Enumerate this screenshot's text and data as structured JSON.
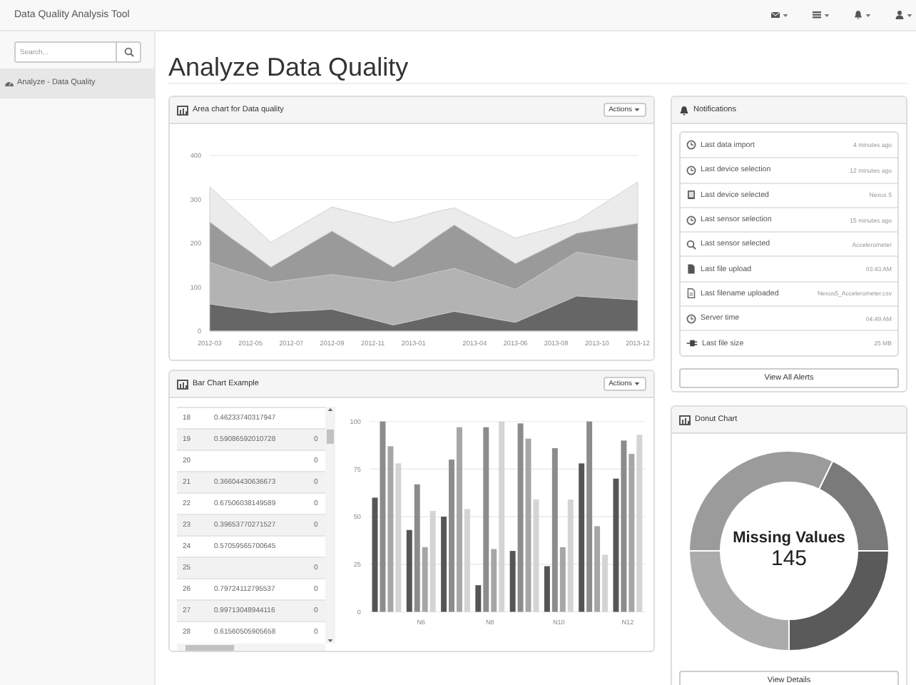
{
  "navbar": {
    "brand": "Data Quality Analysis Tool"
  },
  "sidebar": {
    "search": {
      "placeholder": "Search..."
    },
    "items": [
      {
        "label": "Analyze - Data Quality",
        "selected": true
      }
    ]
  },
  "page_title": "Analyze Data Quality",
  "area_panel": {
    "title": "Area chart for Data quality",
    "actions": "Actions",
    "chart_data": {
      "type": "area",
      "stacked": true,
      "grid": true,
      "ylim": [
        0,
        400
      ],
      "yticks": [
        0,
        100,
        200,
        300,
        400
      ],
      "categories": [
        "2012-03",
        null,
        "2012-05",
        null,
        "2012-07",
        null,
        "2012-09",
        null,
        "2012-11",
        null,
        "2013-01",
        null,
        null,
        "2013-04",
        null,
        "2013-06",
        null,
        "2013-08",
        null,
        "2013-10",
        null,
        "2013-12"
      ],
      "series": [
        {
          "color": "#666666",
          "values": [
            62,
            55,
            49,
            42,
            45,
            47,
            50,
            38,
            26,
            14,
            24,
            35,
            45,
            37,
            28,
            20,
            40,
            60,
            80,
            77,
            74,
            71
          ]
        },
        {
          "color": "#b3b3b3",
          "values": [
            95,
            86,
            78,
            69,
            72,
            76,
            79,
            85,
            91,
            97,
            97,
            98,
            98,
            90,
            83,
            75,
            83,
            92,
            100,
            96,
            92,
            88
          ]
        },
        {
          "color": "#9a9a9a",
          "values": [
            92,
            73,
            54,
            35,
            56,
            78,
            99,
            78,
            56,
            35,
            56,
            78,
            99,
            86,
            72,
            59,
            54,
            48,
            43,
            58,
            72,
            87
          ]
        },
        {
          "color": "#ebebeb",
          "values": [
            80,
            72,
            64,
            56,
            56,
            55,
            55,
            70,
            86,
            101,
            80,
            60,
            39,
            45,
            52,
            58,
            48,
            38,
            28,
            50,
            72,
            94
          ]
        }
      ]
    }
  },
  "bar_panel": {
    "title": "Bar Chart Example",
    "actions": "Actions",
    "table": {
      "rows": [
        {
          "index": "18",
          "value": "0.46233740317947",
          "column_3": ""
        },
        {
          "index": "19",
          "value": "0.59086592010728",
          "column_3": "0"
        },
        {
          "index": "20",
          "value": "",
          "column_3": "0"
        },
        {
          "index": "21",
          "value": "0.36604430636673",
          "column_3": "0"
        },
        {
          "index": "22",
          "value": "0.67506038149589",
          "column_3": "0"
        },
        {
          "index": "23",
          "value": "0.39653770271527",
          "column_3": "0"
        },
        {
          "index": "24",
          "value": "0.57059565700645",
          "column_3": ""
        },
        {
          "index": "25",
          "value": "",
          "column_3": "0"
        },
        {
          "index": "26",
          "value": "0.79724112795537",
          "column_3": "0"
        },
        {
          "index": "27",
          "value": "0.99713048944116",
          "column_3": "0"
        },
        {
          "index": "28",
          "value": "0.61560505905658",
          "column_3": "0"
        }
      ]
    },
    "chart_data": {
      "type": "bar",
      "grid": true,
      "ylim": [
        0,
        100
      ],
      "yticks": [
        0,
        25,
        50,
        75,
        100
      ],
      "categories": [
        null,
        "N6",
        null,
        "N8",
        null,
        "N10",
        null,
        "N12"
      ],
      "series": [
        {
          "color": "#555555",
          "values": [
            60,
            43,
            50,
            14,
            32,
            24,
            78,
            70
          ]
        },
        {
          "color": "#8c8c8c",
          "values": [
            100,
            67,
            80,
            97,
            99,
            86,
            100,
            90
          ]
        },
        {
          "color": "#a6a6a6",
          "values": [
            87,
            34,
            97,
            33,
            91,
            34,
            45,
            83
          ]
        },
        {
          "color": "#d4d4d4",
          "values": [
            78,
            53,
            54,
            100,
            59,
            59,
            30,
            93
          ]
        }
      ]
    }
  },
  "notifications": {
    "title": "Notifications",
    "items": [
      {
        "label": "Last data import",
        "time": "4 minutes ago"
      },
      {
        "label": "Last device selection",
        "time": "12 minutes ago"
      },
      {
        "label": "Last device selected",
        "time": "Nexus 5"
      },
      {
        "label": "Last sensor selection",
        "time": "15 minutes ago"
      },
      {
        "label": "Last sensor selected",
        "time": "Accelerometer"
      },
      {
        "label": "Last file upload",
        "time": "03:43 AM"
      },
      {
        "label": "Last filename uploaded",
        "time": "Nexus5_Accelerometer.csv"
      },
      {
        "label": "Server time",
        "time": "04:49 AM"
      },
      {
        "label": "Last file size",
        "time": "25 MB"
      }
    ],
    "button": "View All Alerts"
  },
  "donut_panel": {
    "title": "Donut Chart",
    "center_label": "Missing Values",
    "center_value": "145",
    "button": "View Details"
  }
}
